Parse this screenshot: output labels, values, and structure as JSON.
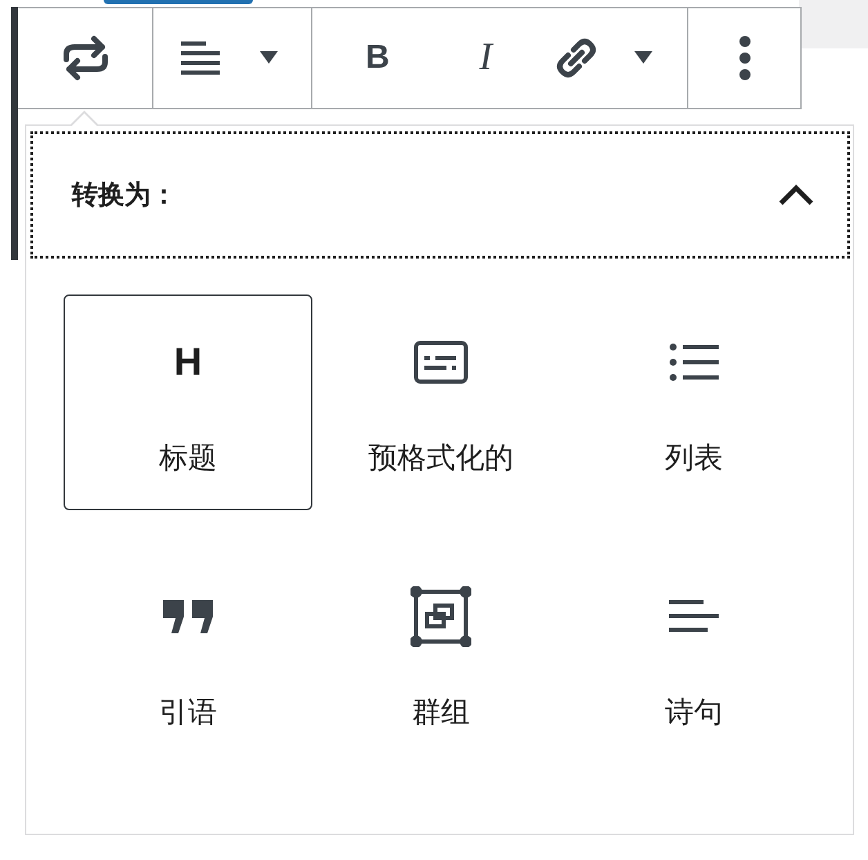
{
  "toolbar": {
    "groups": [
      {
        "buttons": [
          {
            "kind": "transform"
          }
        ]
      },
      {
        "buttons": [
          {
            "kind": "align"
          },
          {
            "kind": "caret"
          }
        ]
      },
      {
        "buttons": [
          {
            "kind": "bold",
            "text": "B"
          },
          {
            "kind": "italic",
            "text": "I"
          },
          {
            "kind": "link"
          },
          {
            "kind": "caret"
          }
        ]
      },
      {
        "buttons": [
          {
            "kind": "more"
          }
        ]
      }
    ]
  },
  "popover": {
    "title": "转换为：",
    "expanded": true,
    "items": [
      {
        "kind": "heading",
        "icon_text": "H",
        "label": "标题",
        "selected": true
      },
      {
        "kind": "preformatted",
        "label": "预格式化的",
        "selected": false
      },
      {
        "kind": "list",
        "label": "列表",
        "selected": false
      },
      {
        "kind": "quote",
        "label": "引语",
        "selected": false
      },
      {
        "kind": "group",
        "label": "群组",
        "selected": false
      },
      {
        "kind": "verse",
        "label": "诗句",
        "selected": false
      }
    ]
  }
}
